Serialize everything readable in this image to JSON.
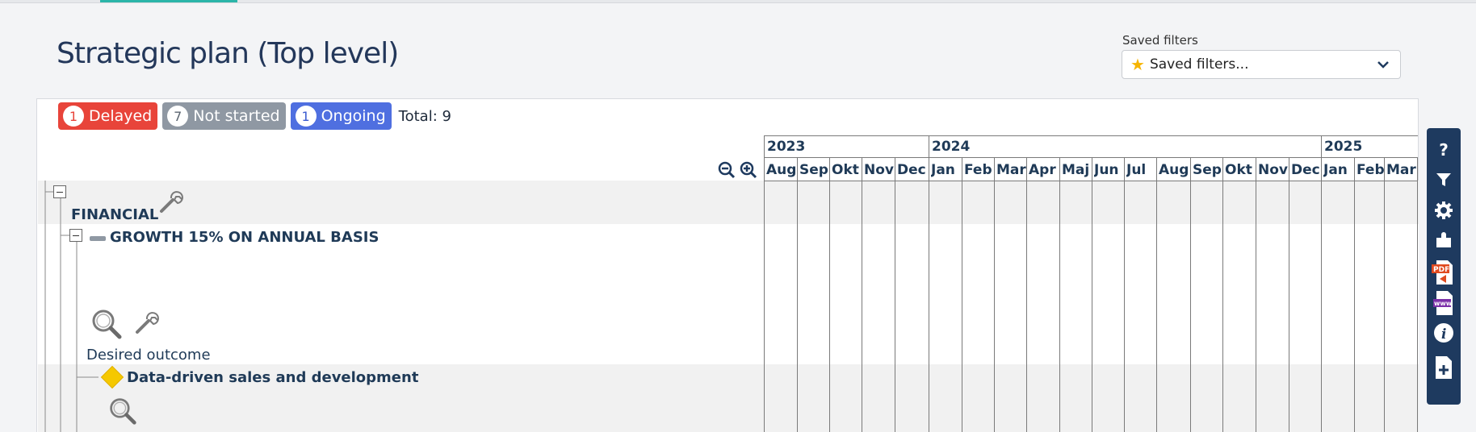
{
  "page": {
    "title": "Strategic plan (Top level)"
  },
  "saved_filters": {
    "label": "Saved filters",
    "placeholder": "Saved filters..."
  },
  "status": {
    "delayed": {
      "count": "1",
      "label": "Delayed"
    },
    "not_started": {
      "count": "7",
      "label": "Not started"
    },
    "ongoing": {
      "count": "1",
      "label": "Ongoing"
    },
    "total": "Total: 9"
  },
  "timeline": {
    "years": [
      "2023",
      "2024",
      "2025"
    ],
    "months": [
      "Aug",
      "Sep",
      "Okt",
      "Nov",
      "Dec",
      "Jan",
      "Feb",
      "Mar",
      "Apr",
      "Maj",
      "Jun",
      "Jul",
      "Aug",
      "Sep",
      "Okt",
      "Nov",
      "Dec",
      "Jan",
      "Feb",
      "Mar"
    ]
  },
  "tree": {
    "financial": "FINANCIAL",
    "growth": "GROWTH 15% ON ANNUAL BASIS",
    "desired_outcome": "Desired outcome",
    "data_driven": "Data-driven sales and development"
  },
  "colors": {
    "delayed": "#e8443a",
    "not_started": "#8f98a3",
    "ongoing": "#4f6fe0",
    "toolbar": "#1e3a5f",
    "milestone": "#f5c800"
  },
  "toolbar_icons": [
    "help-icon",
    "filter-icon",
    "gear-icon",
    "plugin-icon",
    "pdf-export-icon",
    "www-export-icon",
    "info-icon",
    "new-document-icon"
  ]
}
